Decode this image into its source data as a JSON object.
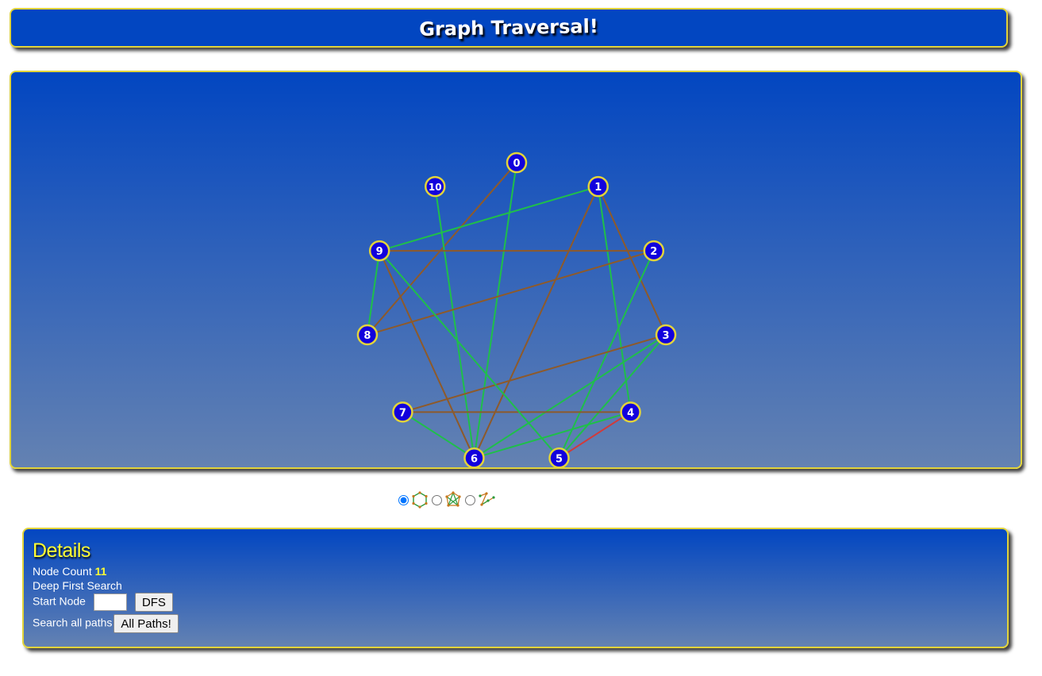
{
  "header": {
    "title": "Graph Traversal!"
  },
  "graph": {
    "node_fill": "#1200dd",
    "node_stroke": "#e2d43a",
    "nodes": [
      {
        "id": "0",
        "label": "0"
      },
      {
        "id": "1",
        "label": "1"
      },
      {
        "id": "2",
        "label": "2"
      },
      {
        "id": "3",
        "label": "3"
      },
      {
        "id": "4",
        "label": "4"
      },
      {
        "id": "5",
        "label": "5"
      },
      {
        "id": "6",
        "label": "6"
      },
      {
        "id": "7",
        "label": "7"
      },
      {
        "id": "8",
        "label": "8"
      },
      {
        "id": "9",
        "label": "9"
      },
      {
        "id": "10",
        "label": "10"
      }
    ],
    "edges": [
      {
        "from": "0",
        "to": "6",
        "color": "#1fbf4a"
      },
      {
        "from": "0",
        "to": "8",
        "color": "#8e5a2a"
      },
      {
        "from": "1",
        "to": "9",
        "color": "#1fbf4a"
      },
      {
        "from": "1",
        "to": "3",
        "color": "#8e5a2a"
      },
      {
        "from": "1",
        "to": "4",
        "color": "#1fbf4a"
      },
      {
        "from": "1",
        "to": "6",
        "color": "#8e5a2a"
      },
      {
        "from": "10",
        "to": "6",
        "color": "#1fbf4a"
      },
      {
        "from": "2",
        "to": "9",
        "color": "#8e5a2a"
      },
      {
        "from": "2",
        "to": "8",
        "color": "#8e5a2a"
      },
      {
        "from": "2",
        "to": "5",
        "color": "#1fbf4a"
      },
      {
        "from": "3",
        "to": "5",
        "color": "#1fbf4a"
      },
      {
        "from": "3",
        "to": "6",
        "color": "#1fbf4a"
      },
      {
        "from": "3",
        "to": "7",
        "color": "#8e5a2a"
      },
      {
        "from": "4",
        "to": "7",
        "color": "#8e5a2a"
      },
      {
        "from": "4",
        "to": "5",
        "color": "#d23a3a"
      },
      {
        "from": "4",
        "to": "6",
        "color": "#1fbf4a"
      },
      {
        "from": "9",
        "to": "8",
        "color": "#1fbf4a"
      },
      {
        "from": "9",
        "to": "5",
        "color": "#1fbf4a"
      },
      {
        "from": "9",
        "to": "6",
        "color": "#8e5a2a"
      },
      {
        "from": "7",
        "to": "6",
        "color": "#1fbf4a"
      }
    ]
  },
  "layout_options": {
    "selected": "circle",
    "options": [
      {
        "id": "circle",
        "icon": "hexagon-layout-icon"
      },
      {
        "id": "force",
        "icon": "mesh-layout-icon"
      },
      {
        "id": "tree",
        "icon": "tree-layout-icon"
      }
    ]
  },
  "details": {
    "heading": "Details",
    "node_count_label": "Node Count",
    "node_count_value": "11",
    "dfs_title": "Deep First Search",
    "start_node_label": "Start Node",
    "start_node_value": "",
    "dfs_button": "DFS",
    "all_paths_label": "Search all paths",
    "all_paths_button": "All Paths!"
  }
}
